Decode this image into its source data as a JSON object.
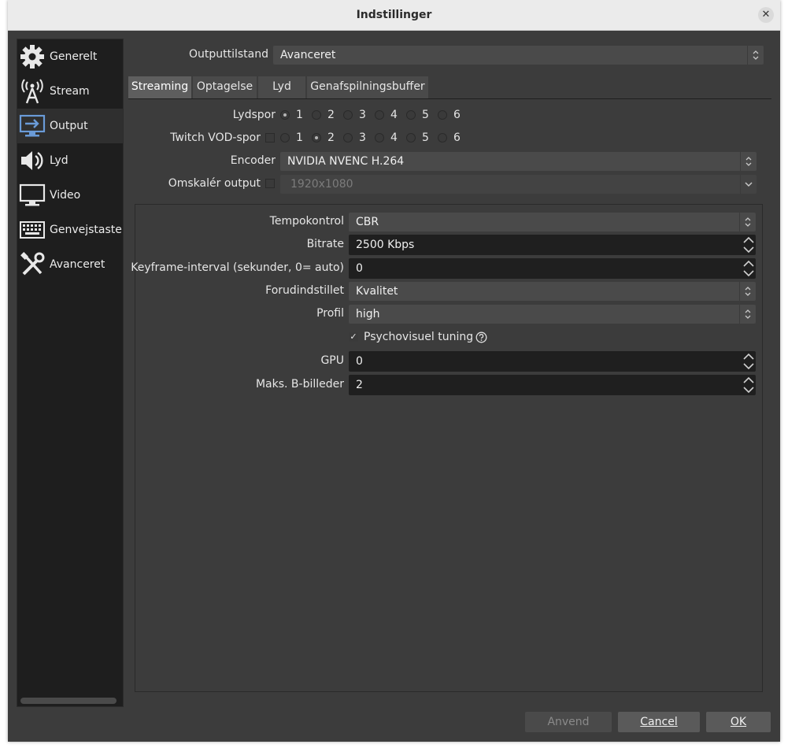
{
  "window": {
    "title": "Indstillinger",
    "close_symbol": "✕"
  },
  "sidebar": {
    "items": [
      {
        "label": "Generelt",
        "icon": "gear-icon"
      },
      {
        "label": "Stream",
        "icon": "broadcast-antenna-icon"
      },
      {
        "label": "Output",
        "icon": "monitor-output-icon",
        "active": true
      },
      {
        "label": "Lyd",
        "icon": "speaker-icon"
      },
      {
        "label": "Video",
        "icon": "display-icon"
      },
      {
        "label": "Genvejstaster",
        "icon": "keyboard-icon"
      },
      {
        "label": "Avanceret",
        "icon": "tools-icon"
      }
    ]
  },
  "output_mode": {
    "label": "Outputtilstand",
    "value": "Avanceret"
  },
  "tabs": [
    {
      "label": "Streaming",
      "active": true
    },
    {
      "label": "Optagelse"
    },
    {
      "label": "Lyd"
    },
    {
      "label": "Genafspilningsbuffer"
    }
  ],
  "audio_track": {
    "label": "Lydspor",
    "options": [
      "1",
      "2",
      "3",
      "4",
      "5",
      "6"
    ],
    "selected": "1"
  },
  "twitch_vod": {
    "label": "Twitch VOD-spor",
    "options": [
      "1",
      "2",
      "3",
      "4",
      "5",
      "6"
    ],
    "selected": "2"
  },
  "encoder": {
    "label": "Encoder",
    "value": "NVIDIA NVENC H.264"
  },
  "rescale": {
    "label": "Omskalér output",
    "value": "1920x1080"
  },
  "encoder_settings": {
    "rate_control": {
      "label": "Tempokontrol",
      "value": "CBR"
    },
    "bitrate": {
      "label": "Bitrate",
      "value": "2500 Kbps"
    },
    "keyframe": {
      "label": "Keyframe-interval (sekunder, 0= auto)",
      "value": "0"
    },
    "preset": {
      "label": "Forudindstillet",
      "value": "Kvalitet"
    },
    "profile": {
      "label": "Profil",
      "value": "high"
    },
    "psycho": {
      "label": "Psychovisuel tuning",
      "check": "✓"
    },
    "gpu": {
      "label": "GPU",
      "value": "0"
    },
    "bframes": {
      "label": "Maks. B-billeder",
      "value": "2"
    }
  },
  "buttons": {
    "apply": "Anvend",
    "cancel": "Cancel",
    "ok": "OK"
  }
}
